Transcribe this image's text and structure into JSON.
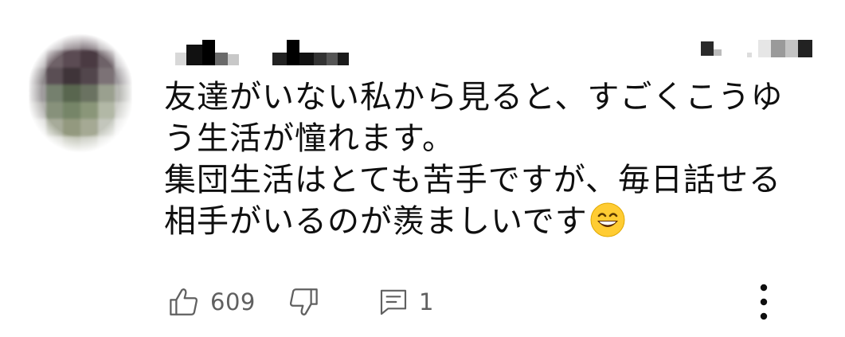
{
  "comment": {
    "text_lines": [
      "友達がいない私から見ると、すごくこうゆ",
      "う生活が憧れます。",
      "集団生活はとても苦手ですが、毎日話せる",
      "相手がいるのが羨ましいです"
    ],
    "emoji": "grinning-face-with-smiling-eyes",
    "author_redacted": true,
    "timestamp_redacted": true
  },
  "actions": {
    "like_icon": "thumbs-up-icon",
    "like_count": "609",
    "dislike_icon": "thumbs-down-icon",
    "reply_icon": "comment-icon",
    "reply_count": "1",
    "more_icon": "more-vertical-icon"
  },
  "colors": {
    "text": "#0f0f0f",
    "secondary_text": "#606060",
    "icon": "#606060",
    "emoji_face": "#ffcc33"
  }
}
